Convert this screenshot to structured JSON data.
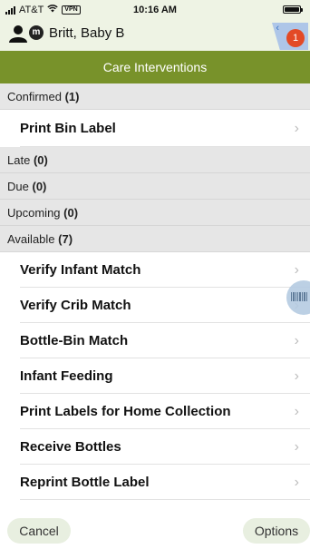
{
  "status_bar": {
    "carrier": "AT&T",
    "vpn": "VPN",
    "time": "10:16 AM"
  },
  "patient": {
    "badge": "m",
    "name": "Britt, Baby B",
    "alert_count": "1"
  },
  "title": "Care Interventions",
  "sections": {
    "confirmed": {
      "label": "Confirmed",
      "count": "(1)"
    },
    "late": {
      "label": "Late",
      "count": "(0)"
    },
    "due": {
      "label": "Due",
      "count": "(0)"
    },
    "upcoming": {
      "label": "Upcoming",
      "count": "(0)"
    },
    "available": {
      "label": "Available",
      "count": "(7)"
    }
  },
  "confirmed_items": [
    "Print Bin Label"
  ],
  "available_items": [
    "Verify Infant Match",
    "Verify Crib Match",
    "Bottle-Bin Match",
    "Infant Feeding",
    "Print Labels for Home Collection",
    "Receive Bottles",
    "Reprint Bottle Label"
  ],
  "bottom_bar": {
    "cancel_label": "Cancel",
    "options_label": "Options"
  },
  "colors": {
    "header_green": "#78922a",
    "alert_red": "#e34a26",
    "status_background": "#eef3e4"
  }
}
